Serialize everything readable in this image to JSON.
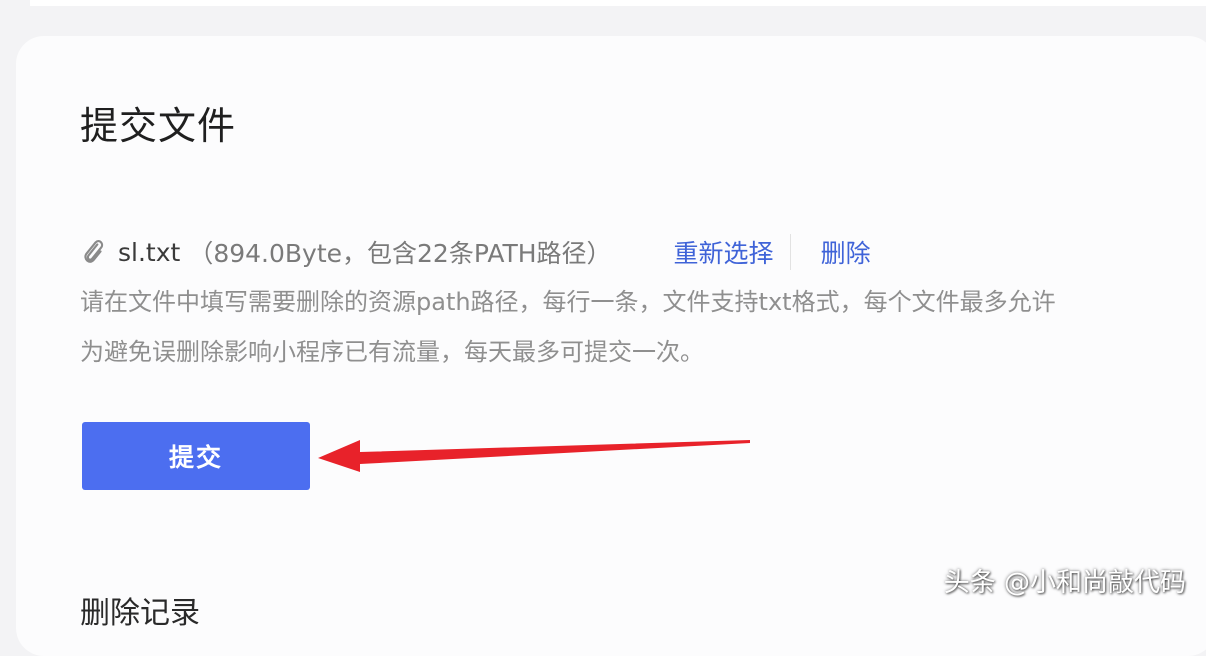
{
  "section": {
    "title": "提交文件"
  },
  "file": {
    "name": "sl.txt",
    "meta": "（894.0Byte，包含22条PATH路径）",
    "reselect_label": "重新选择",
    "delete_label": "删除",
    "icon": "paperclip-icon"
  },
  "tips": {
    "line1": "请在文件中填写需要删除的资源path路径，每行一条，文件支持txt格式，每个文件最多允许",
    "line2": "为避免误删除影响小程序已有流量，每天最多可提交一次。"
  },
  "actions": {
    "submit_label": "提交"
  },
  "records": {
    "heading": "删除记录"
  },
  "watermark": {
    "text": "头条 @小和尚敲代码"
  },
  "colors": {
    "primary": "#4c6ef0",
    "link": "#3f63d8",
    "annotation_arrow": "#e8222a"
  }
}
